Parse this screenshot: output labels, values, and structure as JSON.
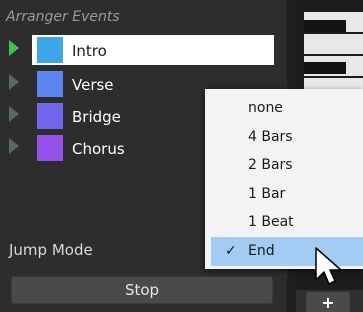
{
  "panel": {
    "title": "Arranger Events",
    "events": [
      {
        "label": "Intro",
        "color": "#3ea6e6",
        "selected": true
      },
      {
        "label": "Verse",
        "color": "#5b86ef",
        "selected": false
      },
      {
        "label": "Bridge",
        "color": "#7266ef",
        "selected": false
      },
      {
        "label": "Chorus",
        "color": "#9550e8",
        "selected": false
      }
    ],
    "jump_mode_label": "Jump Mode",
    "stop_label": "Stop"
  },
  "right_panel": {
    "add_label": "+"
  },
  "jump_menu": {
    "items": [
      "none",
      "4 Bars",
      "2 Bars",
      "1 Bar",
      "1 Beat",
      "End"
    ],
    "checked_item": "End",
    "check_icon": "checkmark-icon"
  },
  "colors": {
    "active_play": "#38c64a",
    "selection": "#a3ccf4"
  }
}
